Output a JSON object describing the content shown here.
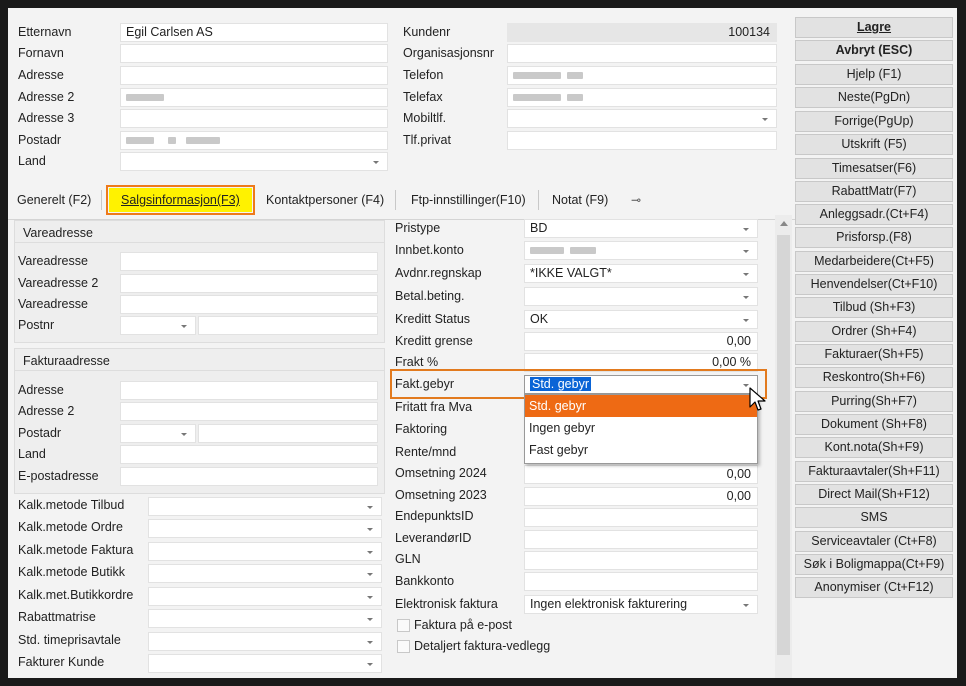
{
  "customer": {
    "labels": {
      "etternavn": "Etternavn",
      "fornavn": "Fornavn",
      "adresse": "Adresse",
      "adresse2": "Adresse 2",
      "adresse3": "Adresse 3",
      "postadr": "Postadr",
      "land": "Land",
      "kundenr": "Kundenr",
      "orgnr": "Organisasjonsnr",
      "telefon": "Telefon",
      "telefax": "Telefax",
      "mobil": "Mobiltlf.",
      "tlfprivat": "Tlf.privat"
    },
    "values": {
      "etternavn": "Egil Carlsen AS",
      "kundenr": "100134"
    }
  },
  "tabs": [
    {
      "label": "Generelt (F2)"
    },
    {
      "label": "Salgsinformasjon(F3)"
    },
    {
      "label": "Kontaktpersoner (F4)"
    },
    {
      "label": "Ftp-innstillinger(F10)"
    },
    {
      "label": "Notat (F9)"
    }
  ],
  "vare": {
    "title": "Vareadresse",
    "labels": [
      "Vareadresse",
      "Vareadresse 2",
      "Vareadresse",
      "Postnr"
    ]
  },
  "faktura": {
    "title": "Fakturaadresse",
    "labels": [
      "Adresse",
      "Adresse 2",
      "Postadr",
      "Land",
      "E-postadresse"
    ]
  },
  "kalk": {
    "labels": [
      "Kalk.metode Tilbud",
      "Kalk.metode Ordre",
      "Kalk.metode Faktura",
      "Kalk.metode Butikk",
      "Kalk.met.Butikkordre",
      "Rabattmatrise",
      "Std. timeprisavtale",
      "Fakturer Kunde"
    ]
  },
  "sales": {
    "labels": {
      "pristype": "Pristype",
      "innbet": "Innbet.konto",
      "avdnr": "Avdnr.regnskap",
      "betal": "Betal.beting.",
      "kredittstatus": "Kreditt Status",
      "kredittgrense": "Kreditt grense",
      "frakt": "Frakt %",
      "faktgebyr": "Fakt.gebyr",
      "fritatt": "Fritatt fra Mva",
      "faktoring": "Faktoring",
      "rente": "Rente/mnd",
      "oms2024": "Omsetning 2024",
      "oms2023": "Omsetning 2023",
      "endepunkt": "EndepunktsID",
      "leverandor": "LeverandørID",
      "gln": "GLN",
      "bankkonto": "Bankkonto",
      "elfaktura": "Elektronisk faktura",
      "fakturaepost": "Faktura på e-post",
      "detaljert": "Detaljert faktura-vedlegg"
    },
    "values": {
      "pristype": "BD",
      "avdnr": "*IKKE VALGT*",
      "kredittstatus": "OK",
      "kredittgrense": "0,00",
      "frakt": "0,00 %",
      "faktgebyr": "Std. gebyr",
      "oms2024": "0,00",
      "oms2023": "0,00",
      "elfaktura": "Ingen elektronisk fakturering"
    },
    "faktgebyr_options": [
      "Std. gebyr",
      "Ingen gebyr",
      "Fast gebyr"
    ]
  },
  "buttons": [
    {
      "label": "Lagre",
      "bold": true
    },
    {
      "label": "Avbryt (ESC)",
      "bold": true
    },
    {
      "label": "Hjelp (F1)"
    },
    {
      "label": "Neste(PgDn)"
    },
    {
      "label": "Forrige(PgUp)"
    },
    {
      "label": "Utskrift (F5)"
    },
    {
      "label": "Timesatser(F6)"
    },
    {
      "label": "RabattMatr(F7)"
    },
    {
      "label": "Anleggsadr.(Ct+F4)"
    },
    {
      "label": "Prisforsp.(F8)"
    },
    {
      "label": "Medarbeidere(Ct+F5)"
    },
    {
      "label": "Henvendelser(Ct+F10)"
    },
    {
      "label": "Tilbud (Sh+F3)"
    },
    {
      "label": "Ordrer (Sh+F4)"
    },
    {
      "label": "Fakturaer(Sh+F5)"
    },
    {
      "label": "Reskontro(Sh+F6)"
    },
    {
      "label": "Purring(Sh+F7)"
    },
    {
      "label": "Dokument (Sh+F8)"
    },
    {
      "label": "Kont.nota(Sh+F9)"
    },
    {
      "label": "Fakturaavtaler(Sh+F11)"
    },
    {
      "label": "Direct Mail(Sh+F12)"
    },
    {
      "label": "SMS"
    },
    {
      "label": "Serviceavtaler (Ct+F8)"
    },
    {
      "label": "Søk i Boligmappa(Ct+F9)"
    },
    {
      "label": "Anonymiser (Ct+F12)"
    }
  ]
}
